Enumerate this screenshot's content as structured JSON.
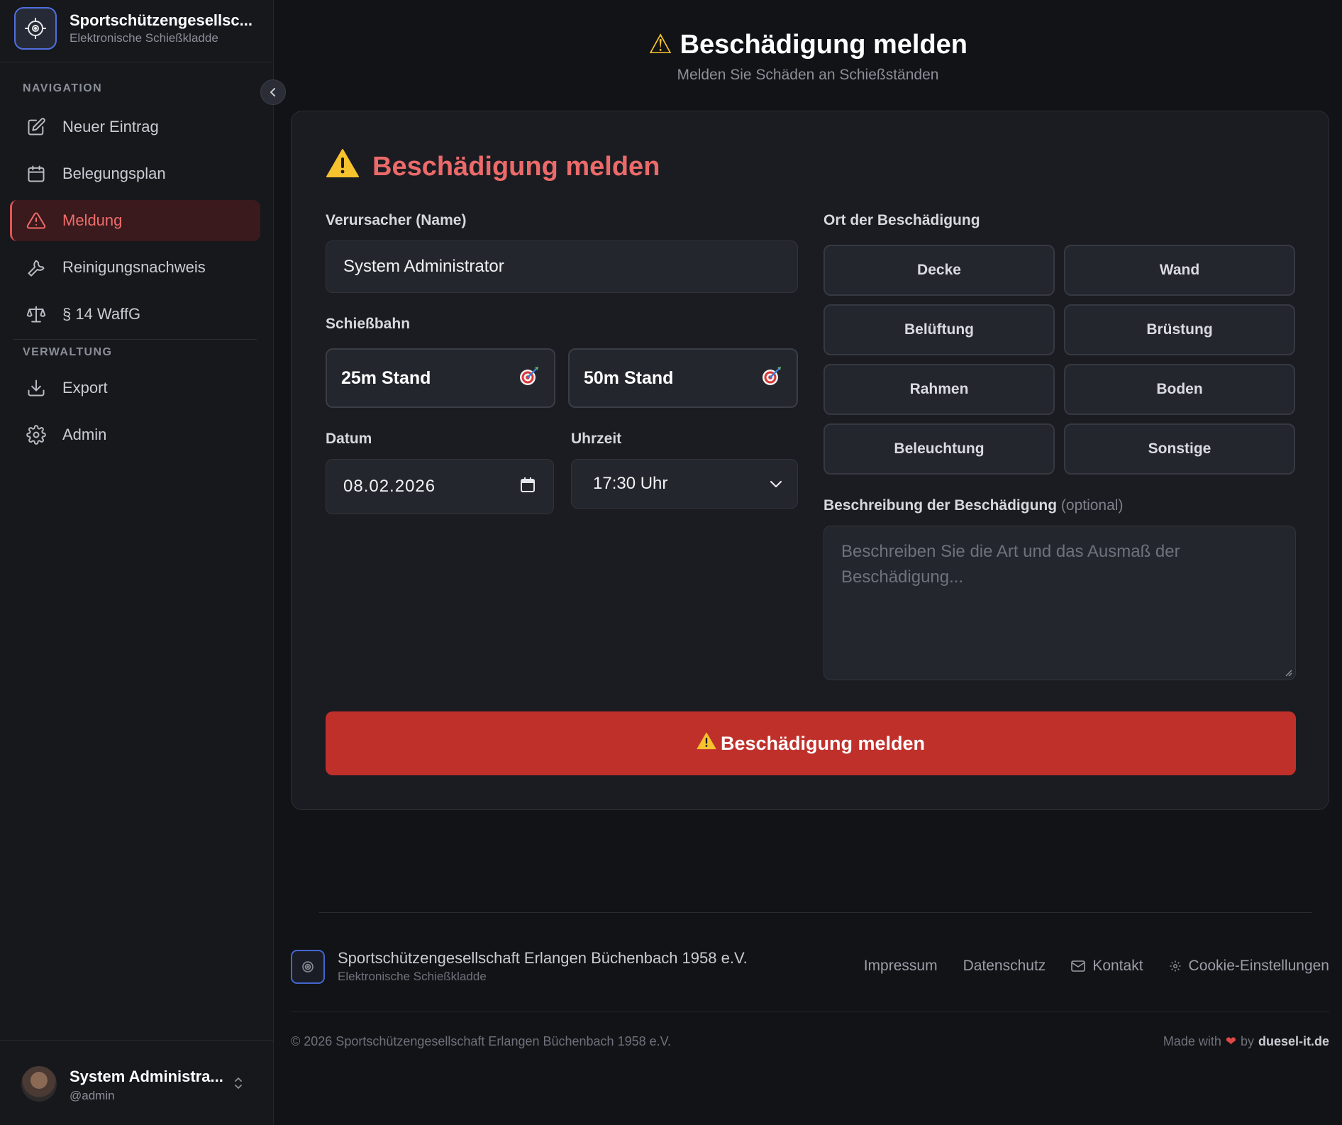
{
  "app": {
    "name": "Sportschützengesellsc...",
    "subtitle": "Elektronische Schießkladde"
  },
  "sidebar": {
    "navigation_label": "NAVIGATION",
    "nav_items": [
      {
        "label": "Neuer Eintrag",
        "icon": "edit-icon"
      },
      {
        "label": "Belegungsplan",
        "icon": "calendar-icon"
      },
      {
        "label": "Meldung",
        "icon": "warning-icon",
        "active": true
      },
      {
        "label": "Reinigungsnachweis",
        "icon": "wrench-icon"
      },
      {
        "label": "§ 14 WaffG",
        "icon": "scale-icon"
      }
    ],
    "admin_label": "VERWALTUNG",
    "admin_items": [
      {
        "label": "Export",
        "icon": "download-icon"
      },
      {
        "label": "Admin",
        "icon": "gear-icon"
      }
    ],
    "user": {
      "name": "System Administra...",
      "handle": "@admin"
    }
  },
  "header": {
    "title": "Beschädigung melden",
    "subtitle": "Melden Sie Schäden an Schießständen"
  },
  "form": {
    "title": "Beschädigung melden",
    "causer_label": "Verursacher (Name)",
    "causer_value": "System Administrator",
    "lane_label": "Schießbahn",
    "lanes": [
      "25m Stand",
      "50m Stand"
    ],
    "date_label": "Datum",
    "date_value": "08.02.2026",
    "time_label": "Uhrzeit",
    "time_value": "17:30 Uhr",
    "location_label": "Ort der Beschädigung",
    "locations": [
      "Decke",
      "Wand",
      "Belüftung",
      "Brüstung",
      "Rahmen",
      "Boden",
      "Beleuchtung",
      "Sonstige"
    ],
    "description_label": "Beschreibung der Beschädigung",
    "description_optional": "(optional)",
    "description_placeholder": "Beschreiben Sie die Art und das Ausmaß der Beschädigung...",
    "submit_label": "Beschädigung melden"
  },
  "footer": {
    "org": "Sportschützengesellschaft Erlangen Büchenbach 1958 e.V.",
    "org_sub": "Elektronische Schießkladde",
    "links": {
      "impressum": "Impressum",
      "datenschutz": "Datenschutz",
      "kontakt": "Kontakt",
      "cookies": "Cookie-Einstellungen"
    },
    "copyright": "© 2026 Sportschützengesellschaft Erlangen Büchenbach 1958 e.V.",
    "made_with": "Made with",
    "by": "by",
    "brand": "duesel-it.de"
  },
  "colors": {
    "accent_red": "#c0302b",
    "title_red": "#ec6a6a",
    "brand_blue": "#4f6fe0"
  }
}
